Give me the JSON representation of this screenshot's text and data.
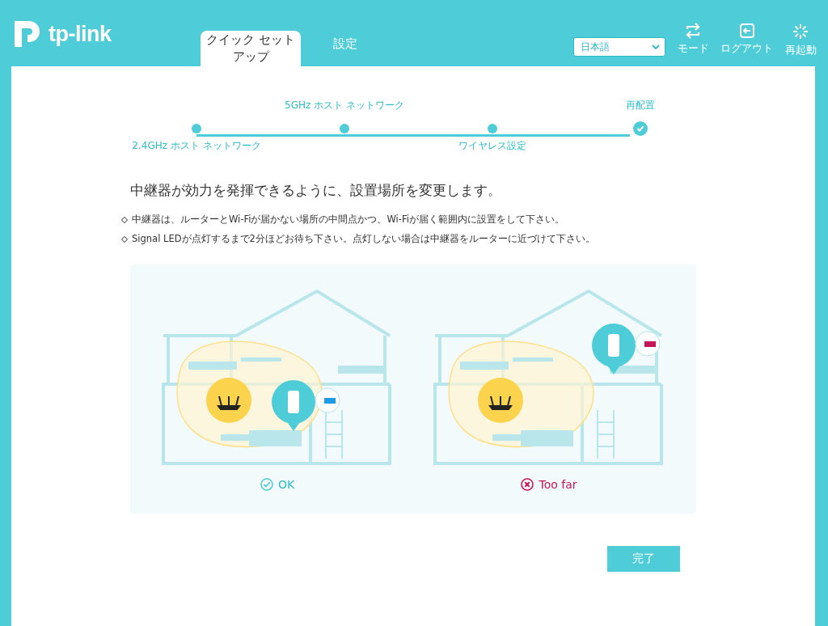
{
  "header": {
    "logo": "tp-link",
    "tabs": [
      {
        "label": "クイック セットアップ",
        "selected": true
      },
      {
        "label": "設定",
        "selected": false
      }
    ],
    "language": {
      "value": "日本語"
    },
    "actions": [
      {
        "label": "モード",
        "kind": "mode"
      },
      {
        "label": "ログアウト",
        "kind": "logout"
      },
      {
        "label": "再起動",
        "kind": "reboot"
      }
    ]
  },
  "steps": [
    {
      "label": "2.4GHz ホスト ネットワーク",
      "selected": false
    },
    {
      "label": "5GHz ホスト ネットワーク",
      "selected": false
    },
    {
      "label": "ワイヤレス設定",
      "selected": false
    },
    {
      "label": "再配置",
      "selected": true
    }
  ],
  "heading": "中継器が効力を発揮できるように、設置場所を変更します。",
  "notes": [
    "中継器は、ルーターとWi-Fiが届かない場所の中間点かつ、Wi-Fiが届く範囲内に設置をして下さい。",
    "Signal LEDが点灯するまで2分ほどお待ち下さい。点灯しない場合は中継器をルーターに近づけて下さい。"
  ],
  "scenarios": [
    {
      "kind": "ok",
      "label": "OK"
    },
    {
      "kind": "too_far",
      "label": "Too far"
    }
  ],
  "finish_button": "完了"
}
